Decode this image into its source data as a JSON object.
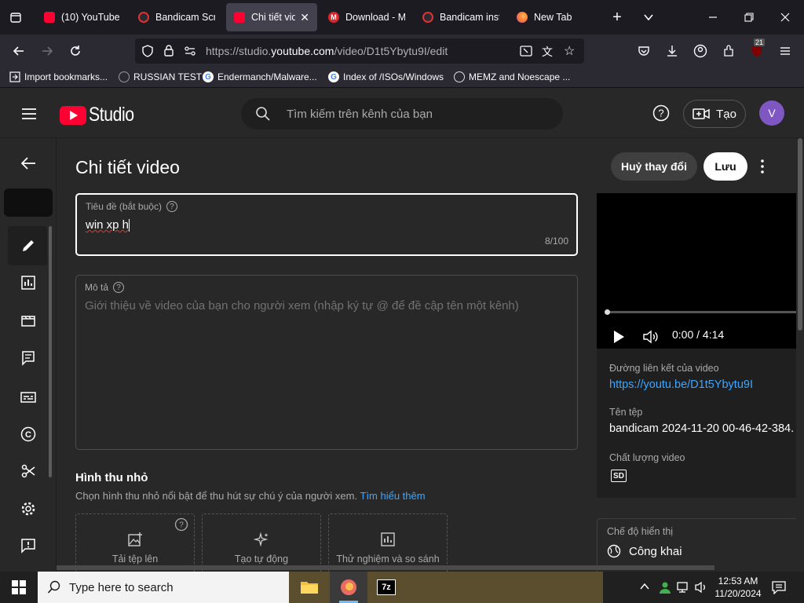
{
  "browser": {
    "tabs": [
      {
        "label": "(10) YouTube",
        "favicon": "youtube-icon",
        "color": "#ff0033",
        "active": false
      },
      {
        "label": "Bandicam Scre",
        "favicon": "record-icon",
        "color": "#e03131",
        "active": false
      },
      {
        "label": "Chi tiết vide",
        "favicon": "youtube-icon",
        "color": "#ff0033",
        "active": true
      },
      {
        "label": "Download - M",
        "favicon": "mega-icon",
        "color": "#d9272e",
        "active": false
      },
      {
        "label": "Bandicam insta",
        "favicon": "record-icon",
        "color": "#e03131",
        "active": false
      },
      {
        "label": "New Tab",
        "favicon": "firefox-icon",
        "color": "#ff7139",
        "active": false
      }
    ],
    "url_prefix": "https://studio.",
    "url_domain": "youtube.com",
    "url_path": "/video/D1t5Ybytu9I/edit",
    "extension_badge": "21",
    "bookmarks": [
      {
        "label": "Import bookmarks...",
        "icon": "import-icon"
      },
      {
        "label": "RUSSIAN TEST",
        "icon": "globe-icon"
      },
      {
        "label": "Endermanch/Malware...",
        "icon": "google-icon"
      },
      {
        "label": "Index of /ISOs/Windows",
        "icon": "google-icon"
      },
      {
        "label": "MEMZ and Noescape ...",
        "icon": "globe-icon"
      }
    ]
  },
  "studio": {
    "logo_text": "Studio",
    "search_placeholder": "Tìm kiếm trên kênh của bạn",
    "create_label": "Tạo",
    "avatar_letter": "V",
    "page_title": "Chi tiết video",
    "undo_label": "Huỷ thay đổi",
    "save_label": "Lưu",
    "title_field": {
      "label": "Tiêu đề (bắt buộc)",
      "value": "win xp h",
      "counter": "8/100"
    },
    "description_field": {
      "label": "Mô tả",
      "placeholder": "Giới thiệu về video của bạn cho người xem (nhập ký tự @ để đề cập tên một kênh)"
    },
    "thumbnail": {
      "heading": "Hình thu nhỏ",
      "subtitle": "Chọn hình thu nhỏ nổi bật để thu hút sự chú ý của người xem.",
      "learn_more": "Tìm hiểu thêm",
      "options": [
        "Tải tệp lên",
        "Tạo tự động",
        "Thử nghiệm và so sánh"
      ]
    },
    "player": {
      "time": "0:00 / 4:14",
      "progress": 0.0
    },
    "video_info": {
      "link_label": "Đường liên kết của video",
      "link_value": "https://youtu.be/D1t5Ybytu9I",
      "file_label": "Tên tệp",
      "file_value": "bandicam 2024-11-20 00-46-42-384.",
      "quality_label": "Chất lượng video",
      "quality_badge": "SD"
    },
    "visibility": {
      "label": "Chế độ hiển thị",
      "value": "Công khai"
    }
  },
  "taskbar": {
    "search_placeholder": "Type here to search",
    "time": "12:53 AM",
    "date": "11/20/2024"
  },
  "colors": {
    "accent_link": "#3ea6ff",
    "youtube_red": "#ff0033",
    "avatar": "#7e57c2"
  }
}
